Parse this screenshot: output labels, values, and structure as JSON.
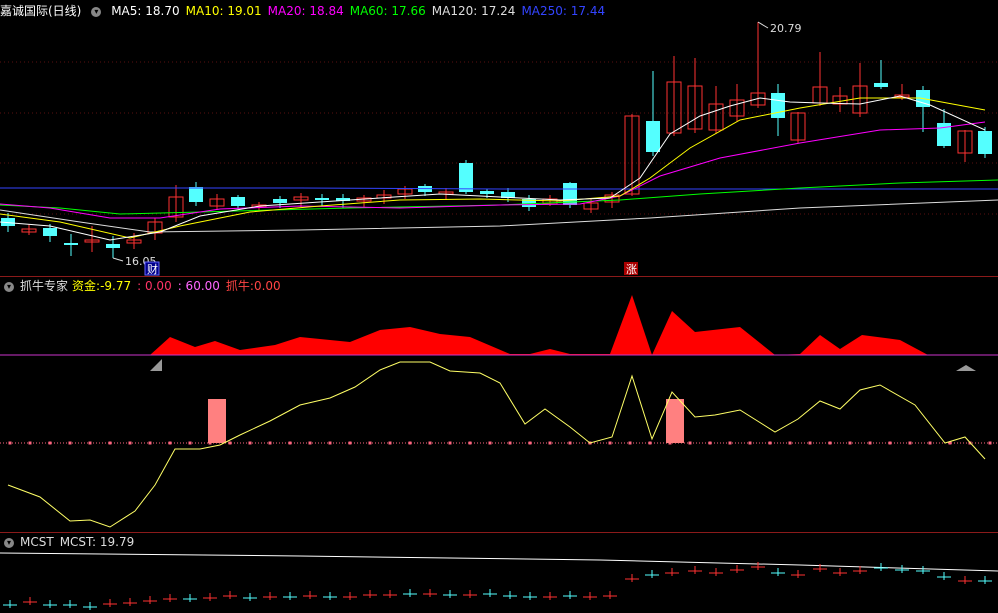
{
  "main_header": {
    "title": "嘉诚国际(日线)",
    "ma": [
      {
        "label": "MA5: 18.70",
        "color": "#ffffff"
      },
      {
        "label": "MA10: 19.01",
        "color": "#ffff00"
      },
      {
        "label": "MA20: 18.84",
        "color": "#ff00ff"
      },
      {
        "label": "MA60: 17.66",
        "color": "#00ff00"
      },
      {
        "label": "MA120: 17.24",
        "color": "#dddddd"
      },
      {
        "label": "MA250: 17.44",
        "color": "#3344ff"
      }
    ]
  },
  "price_annotations": {
    "high": "20.79",
    "low": "16.05"
  },
  "markers": {
    "cai": "财",
    "zhang": "涨"
  },
  "indicator_header": {
    "name": "抓牛专家",
    "zijin_label": "资金:",
    "zijin_value": "-9.77",
    "v2": ": 0.00",
    "v3": ": 60.00",
    "zhuaniu_label": "抓牛:",
    "zhuaniu_value": "0.00"
  },
  "mcst_header": {
    "name": "MCST",
    "label": "MCST: 19.79"
  },
  "colors": {
    "up": "#ff3232",
    "down": "#54ffff",
    "red_fill": "#ff0000",
    "pink": "#ff8080"
  }
}
